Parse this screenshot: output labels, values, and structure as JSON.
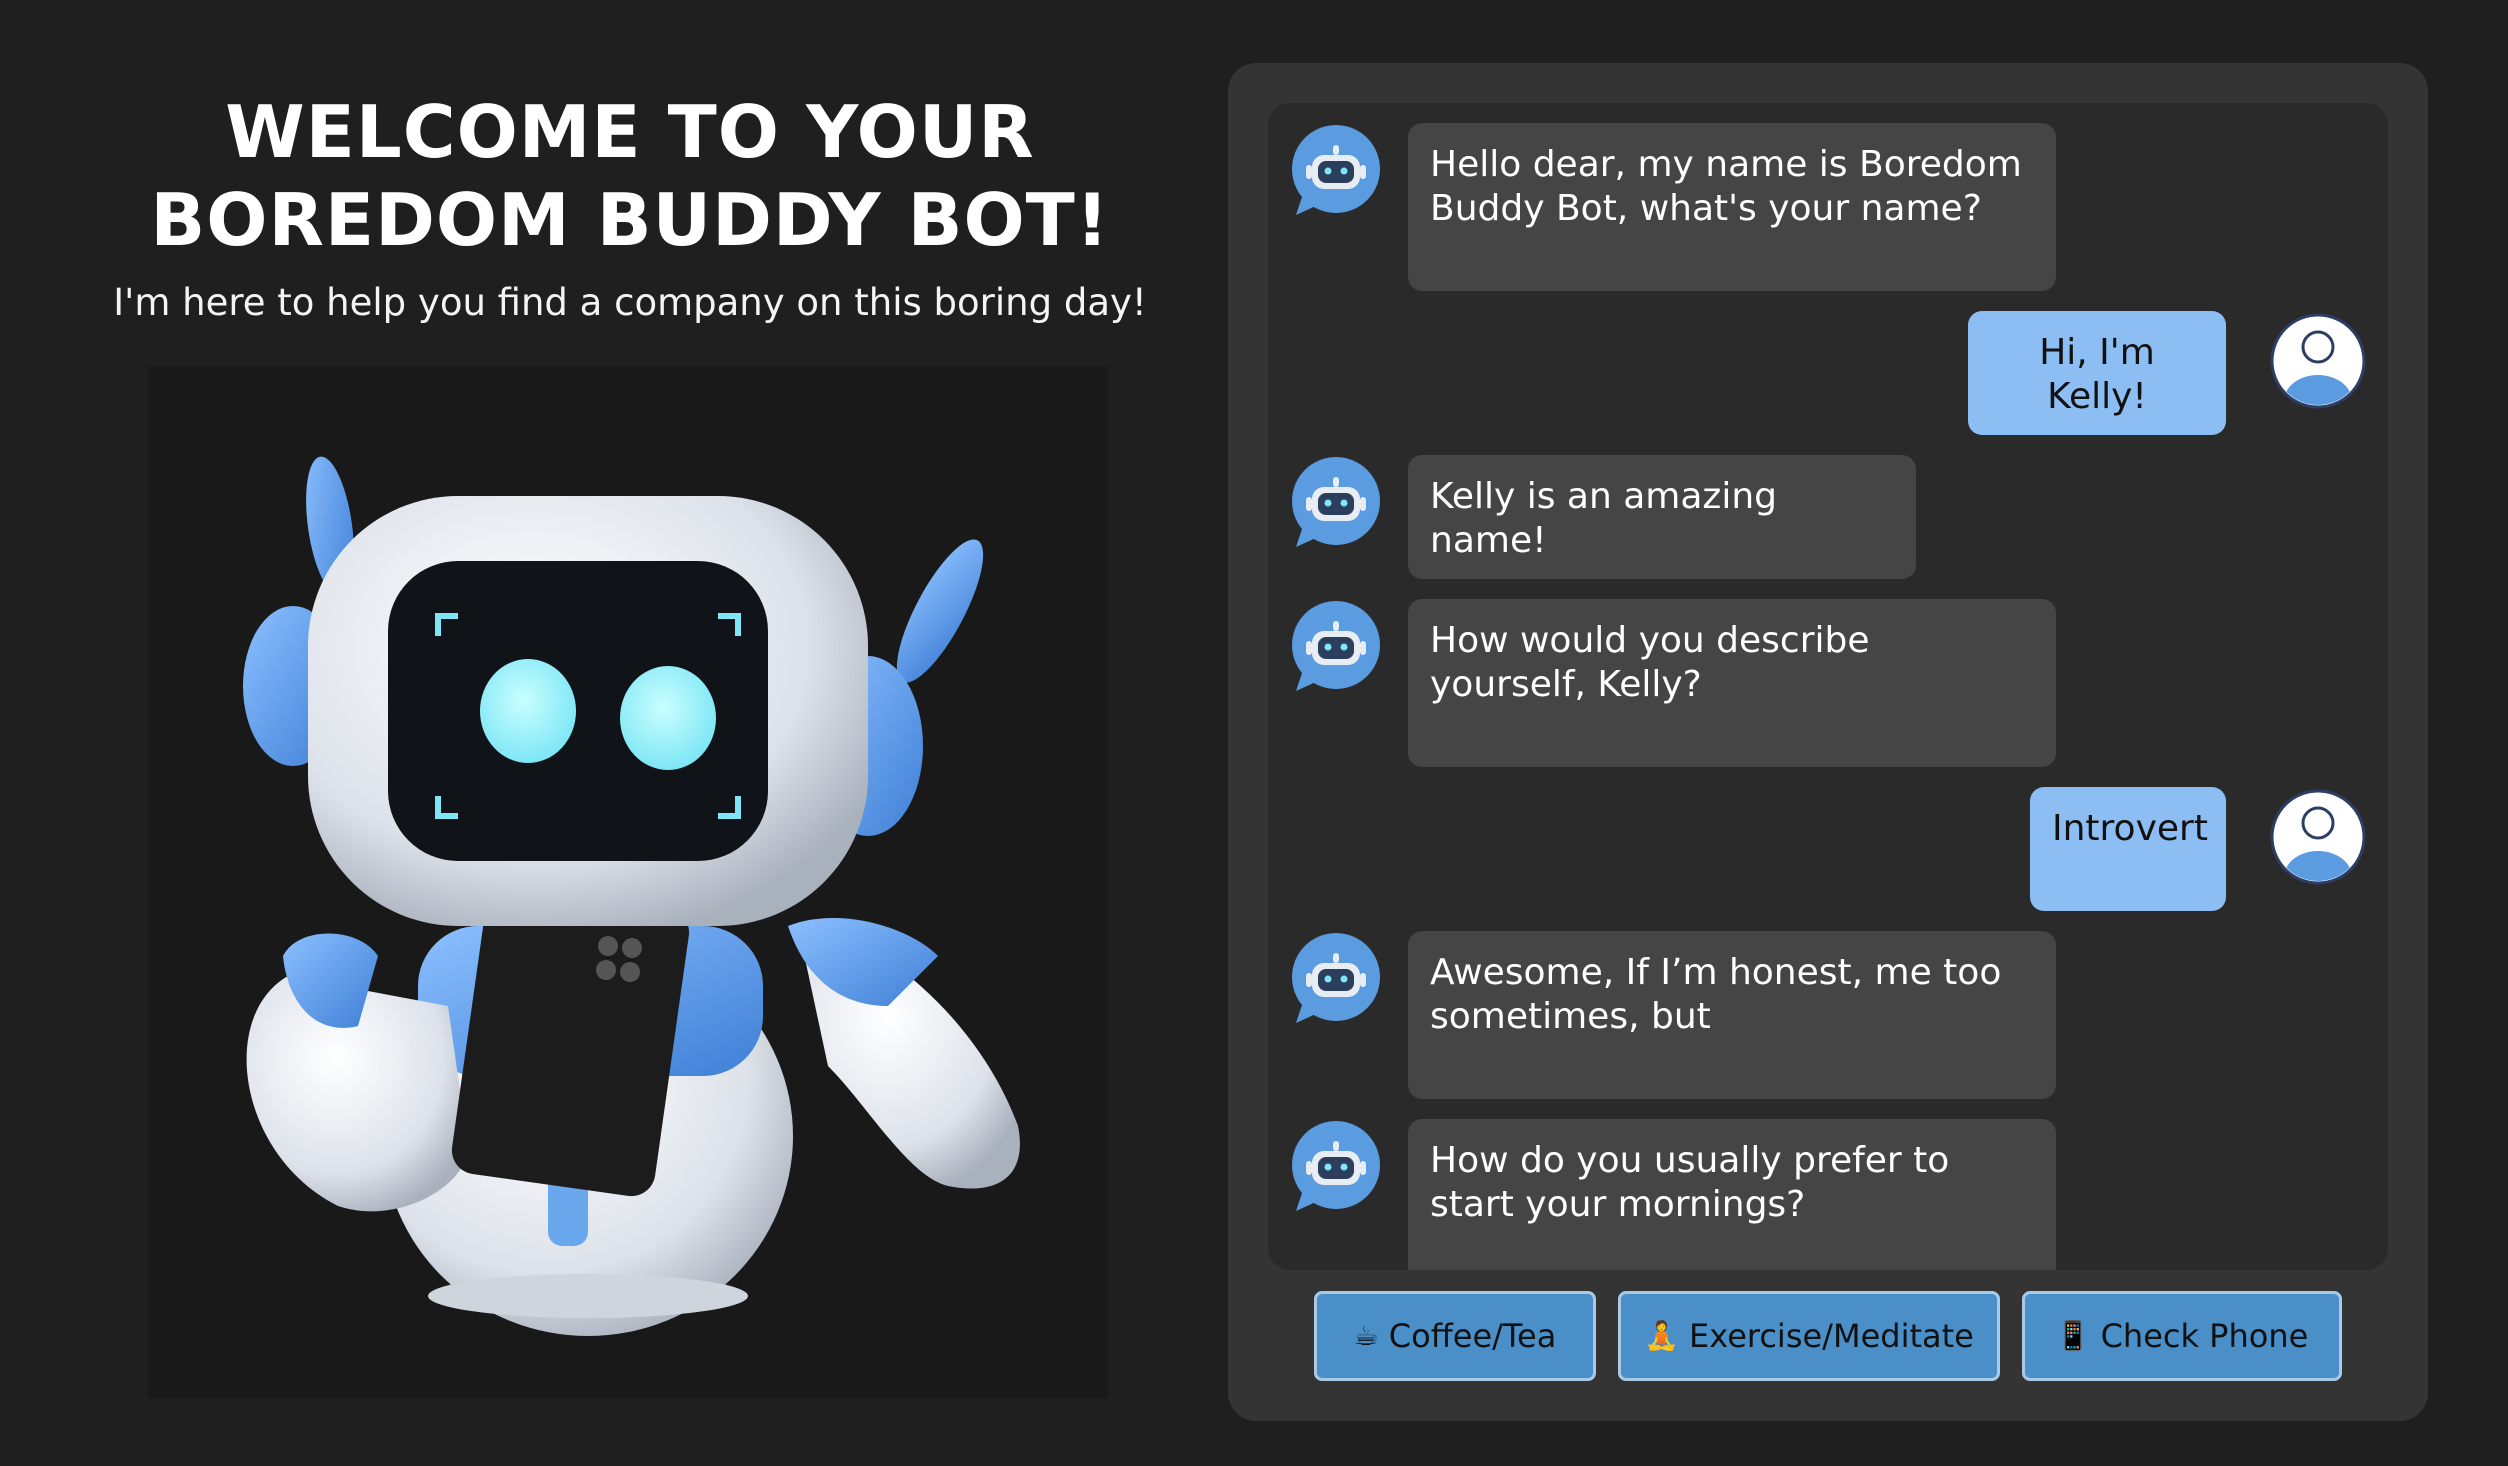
{
  "hero": {
    "title_line1": "WELCOME TO YOUR",
    "title_line2": "BOREDOM BUDDY BOT!",
    "subtitle": "I'm here to help you find a company on this boring day!",
    "image_icon": "robot-illustration"
  },
  "colors": {
    "page_bg": "#1f1f1f",
    "panel_bg": "#343434",
    "messages_bg": "#2a2a2a",
    "bot_bubble": "#454545",
    "user_bubble": "#8cbef4",
    "button_bg": "#4a8fc8",
    "accent_blue": "#5b9be0"
  },
  "chat": {
    "messages": [
      {
        "sender": "bot",
        "avatar_icon": "bot-chat-icon",
        "text": "Hello dear, my name is Boredom Buddy Bot, what's your name?"
      },
      {
        "sender": "user",
        "avatar_icon": "user-avatar-icon",
        "text": "Hi, I'm Kelly!"
      },
      {
        "sender": "bot",
        "avatar_icon": "bot-chat-icon",
        "text": "Kelly is an amazing name!"
      },
      {
        "sender": "bot",
        "avatar_icon": "bot-chat-icon",
        "text": "How would you describe yourself, Kelly?"
      },
      {
        "sender": "user",
        "avatar_icon": "user-avatar-icon",
        "text": "Introvert"
      },
      {
        "sender": "bot",
        "avatar_icon": "bot-chat-icon",
        "text": "Awesome, If I’m honest, me too sometimes, but"
      },
      {
        "sender": "bot",
        "avatar_icon": "bot-chat-icon",
        "text": "How do you usually prefer to start your mornings?"
      }
    ]
  },
  "quick_replies": [
    {
      "icon": "☕",
      "icon_name": "coffee-icon",
      "label": "Coffee/Tea"
    },
    {
      "icon": "🧘",
      "icon_name": "meditate-icon",
      "label": "Exercise/Meditate"
    },
    {
      "icon": "📱",
      "icon_name": "phone-icon",
      "label": "Check Phone"
    }
  ]
}
